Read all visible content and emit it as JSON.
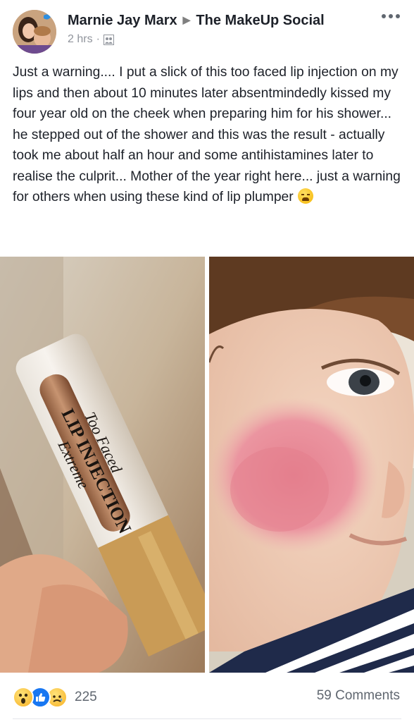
{
  "post": {
    "author": "Marnie Jay Marx",
    "group": "The MakeUp Social",
    "time": "2 hrs",
    "dot": "·",
    "text": "Just a warning.... I put a slick of this too faced lip injection on my lips and then about 10 minutes later absentmindedly kissed my four year old on the cheek when preparing him for his shower... he stepped out of the shower and this was the result - actually took me about half an hour and some antihistamines later to realise the culprit... Mother of the year right here... just a warning for others when using these kind of lip plumper"
  },
  "photos": {
    "left": {
      "brand": "Too Faced",
      "product": "LIP INJECTION",
      "variant": "Extreme"
    }
  },
  "footer": {
    "reaction_count": "225",
    "comments": "59 Comments"
  },
  "icons": {
    "header": [
      "avatar",
      "right-arrow-icon",
      "group-privacy-icon",
      "more-options-icon"
    ],
    "reactions": [
      "wow-reaction-icon",
      "like-reaction-icon",
      "sad-reaction-icon"
    ],
    "inline": [
      "tired-face-emoji-icon"
    ]
  },
  "colors": {
    "text": "#1d2129",
    "secondary": "#90949c",
    "like_blue": "#1877f2",
    "rash_pink": "#e5808f"
  }
}
